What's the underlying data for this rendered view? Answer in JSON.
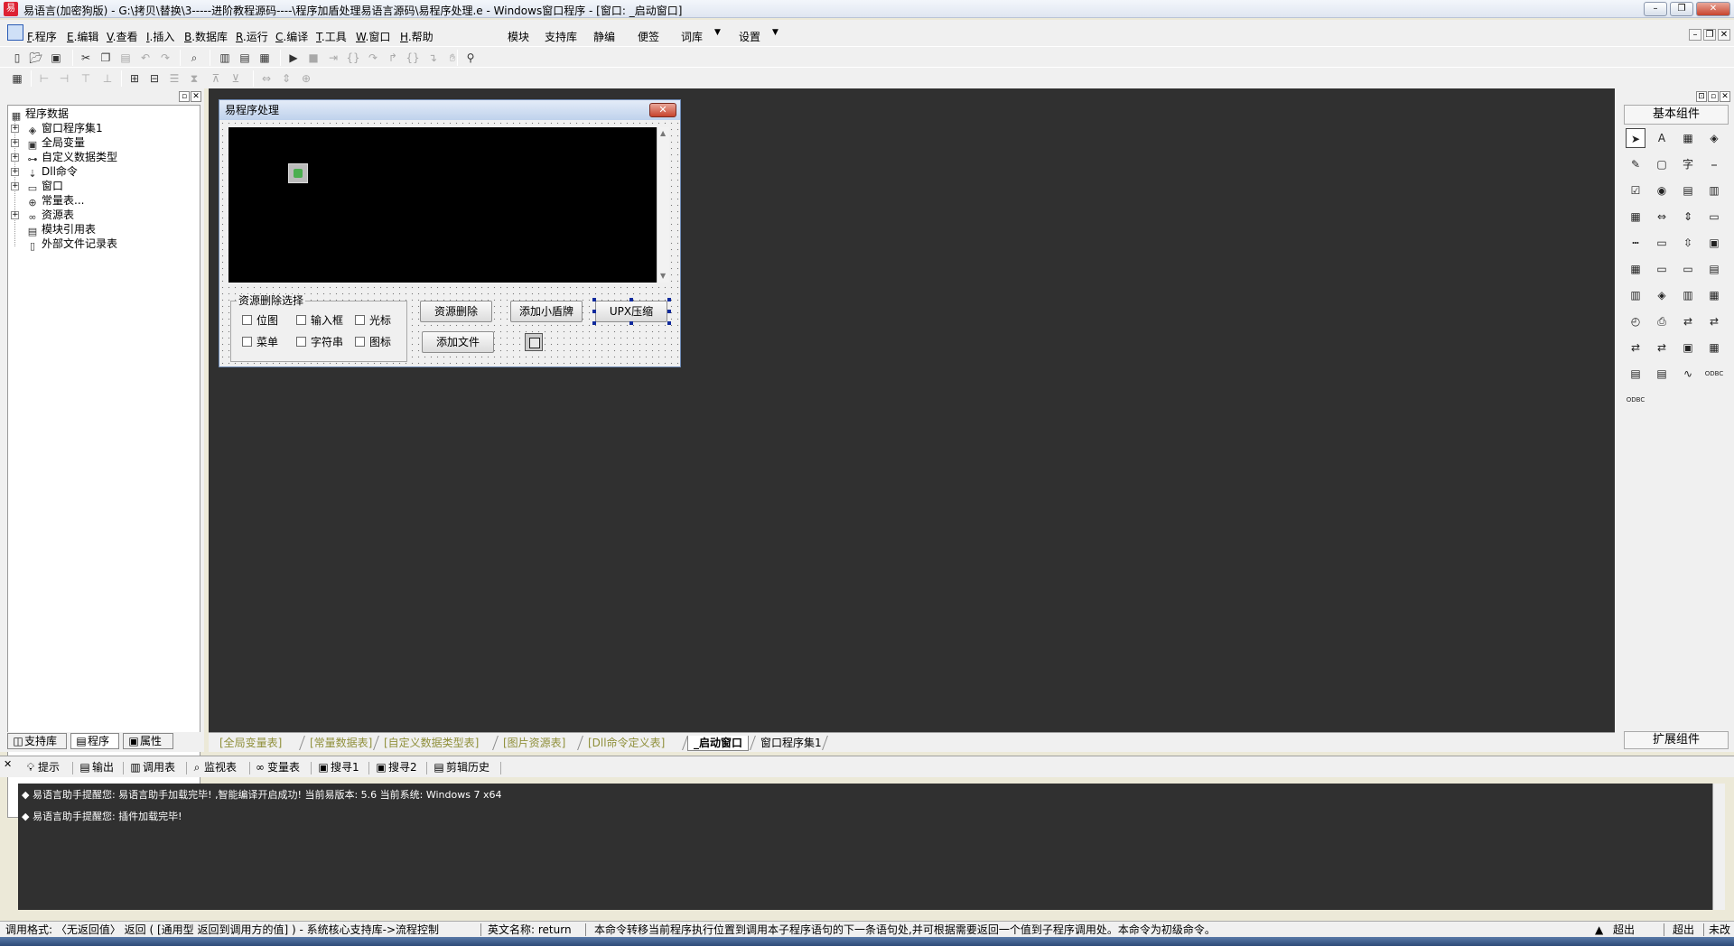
{
  "window": {
    "title": "易语言(加密狗版) - G:\\拷贝\\替换\\3-----进阶教程源码----\\程序加盾处理易语言源码\\易程序处理.e - Windows窗口程序 - [窗口: _启动窗口]",
    "minimize": "–",
    "restore": "❐",
    "close": "✕"
  },
  "menu": {
    "items": [
      {
        "key": "F",
        "label": ".程序"
      },
      {
        "key": "E",
        "label": ".编辑"
      },
      {
        "key": "V",
        "label": ".查看"
      },
      {
        "key": "I",
        "label": ".插入"
      },
      {
        "key": "B",
        "label": ".数据库"
      },
      {
        "key": "R",
        "label": ".运行"
      },
      {
        "key": "C",
        "label": ".编译"
      },
      {
        "key": "T",
        "label": ".工具"
      },
      {
        "key": "W",
        "label": ".窗口"
      },
      {
        "key": "H",
        "label": ".帮助"
      }
    ],
    "extra": [
      "模块",
      "支持库",
      "静编",
      "便签",
      "词库",
      "设置"
    ],
    "dropdown_glyph": "▼",
    "mdi": [
      "–",
      "❐",
      "✕"
    ]
  },
  "toolbar1": {
    "icons": [
      "new-icon",
      "open-icon",
      "save-icon",
      "cut-icon",
      "copy-icon",
      "paste-icon",
      "undo-icon",
      "redo-icon",
      "find-icon",
      "layout-1-icon",
      "layout-2-icon",
      "layout-3-icon",
      "run-icon",
      "stop-icon",
      "step-icon",
      "step-into-icon",
      "step-over-icon",
      "step-out-icon",
      "run-to-icon",
      "hand-icon",
      "binoculars-icon"
    ]
  },
  "left_panel": {
    "tree_root": "程序数据",
    "tree_items": [
      {
        "label": "窗口程序集1",
        "icon": "module-icon",
        "expand": "+"
      },
      {
        "label": "全局变量",
        "icon": "variable-icon",
        "expand": "+"
      },
      {
        "label": "自定义数据类型",
        "icon": "type-icon",
        "expand": "+"
      },
      {
        "label": "Dll命令",
        "icon": "dll-icon",
        "expand": "+"
      },
      {
        "label": "窗口",
        "icon": "window-icon",
        "expand": "+"
      },
      {
        "label": "常量表...",
        "icon": "constant-icon",
        "expand": ""
      },
      {
        "label": "资源表",
        "icon": "resource-icon",
        "expand": "+"
      },
      {
        "label": "模块引用表",
        "icon": "module-ref-icon",
        "expand": ""
      },
      {
        "label": "外部文件记录表",
        "icon": "file-record-icon",
        "expand": ""
      }
    ],
    "tabs": [
      {
        "label": "支持库",
        "icon": "library-icon"
      },
      {
        "label": "程序",
        "icon": "program-icon"
      },
      {
        "label": "属性",
        "icon": "property-icon"
      }
    ]
  },
  "form": {
    "title": "易程序处理",
    "close": "✕",
    "group_title": "资源删除选择",
    "checkboxes": [
      "位图",
      "输入框",
      "光标",
      "菜单",
      "字符串",
      "图标"
    ],
    "buttons": {
      "delete_resource": "资源删除",
      "add_shield": "添加小盾牌",
      "upx": "UPX压缩",
      "add_file": "添加文件"
    }
  },
  "designer_tabs": [
    "[全局变量表]",
    "[常量数据表]",
    "[自定义数据类型表]",
    "[图片资源表]",
    "[Dll命令定义表]",
    "_启动窗口",
    "窗口程序集1"
  ],
  "right_panel": {
    "header": "基本组件",
    "footer": "扩展组件",
    "components": [
      "pointer-icon",
      "label-icon",
      "picture-box-icon",
      "shape-icon",
      "edit-box-icon",
      "image-box-icon",
      "text-icon",
      "line-icon",
      "checkbox-icon",
      "radio-icon",
      "listbox-icon",
      "combo-list-icon",
      "grid-icon",
      "hscroll-icon",
      "vscroll-icon",
      "progress-icon",
      "slider-icon",
      "frame-icon",
      "updown-icon",
      "video-icon",
      "calendar-icon",
      "status-icon",
      "drive-icon",
      "file-list-icon",
      "tab-icon",
      "tray-icon",
      "split-icon",
      "table-icon",
      "timer-icon",
      "printer-icon",
      "data-source-icon",
      "data-link-icon",
      "socket-icon",
      "client-icon",
      "panel-icon",
      "dbgrid-icon",
      "db-provider-icon",
      "db-link-icon",
      "chart-icon",
      "odbc-icon",
      "odbc-2-icon"
    ],
    "component_glyphs": [
      "➤",
      "A",
      "▦",
      "◈",
      "✎",
      "▢",
      "字",
      "⎯",
      "☑",
      "◉",
      "▤",
      "▥",
      "▦",
      "⇔",
      "⇕",
      "▭",
      "┅",
      "▭",
      "⇳",
      "▣",
      "▦",
      "▭",
      "▭",
      "▤",
      "▥",
      "◈",
      "▥",
      "▦",
      "◴",
      "⎙",
      "⇄",
      "⇄",
      "⇄",
      "⇄",
      "▣",
      "▦",
      "▤",
      "▤",
      "∿",
      "ODBC",
      "ODBC"
    ],
    "pin": "⊡",
    "close": "✕"
  },
  "bottom_tabs": [
    {
      "label": "提示",
      "icon": "hint-icon"
    },
    {
      "label": "输出",
      "icon": "output-icon"
    },
    {
      "label": "调用表",
      "icon": "call-table-icon"
    },
    {
      "label": "监视表",
      "icon": "watch-icon"
    },
    {
      "label": "变量表",
      "icon": "variable-table-icon"
    },
    {
      "label": "搜寻1",
      "icon": "search1-icon"
    },
    {
      "label": "搜寻2",
      "icon": "search2-icon"
    },
    {
      "label": "剪辑历史",
      "icon": "clipboard-history-icon"
    }
  ],
  "output": {
    "lines": [
      "◆ 易语言助手提醒您: 易语言助手加载完毕! ,智能编译开启成功! 当前易版本: 5.6  当前系统: Windows 7 x64",
      "◆ 易语言助手提醒您: 插件加载完毕!"
    ]
  },
  "status": {
    "call_format": "调用格式: 〈无返回值〉 返回 ( [通用型 返回到调用方的值] ) - 系统核心支持库->流程控制",
    "english_name": "英文名称: return",
    "description": "本命令转移当前程序执行位置到调用本子程序语句的下一条语句处,并可根据需要返回一个值到子程序调用处。本命令为初级命令。",
    "mode1": "超出",
    "mode2": "超出",
    "mode3": "未改"
  }
}
